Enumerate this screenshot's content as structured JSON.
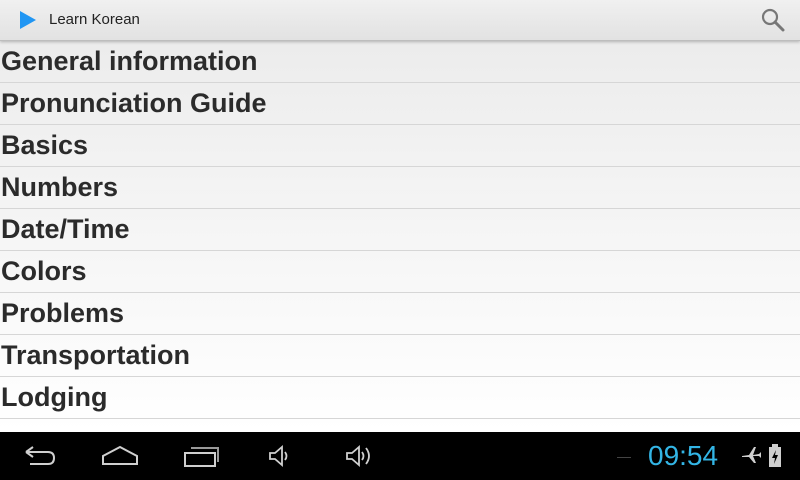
{
  "action_bar": {
    "app_icon": "play-triangle-icon",
    "title": "Learn Korean",
    "search_icon": "search-icon"
  },
  "list": {
    "items": [
      "General information",
      "Pronunciation Guide",
      "Basics",
      "Numbers",
      "Date/Time",
      "Colors",
      "Problems",
      "Transportation",
      "Lodging"
    ]
  },
  "nav_bar": {
    "buttons": [
      "back-icon",
      "home-icon",
      "recent-apps-icon",
      "volume-down-icon",
      "volume-up-icon"
    ],
    "clock": "09:54",
    "status_icons": [
      "airplane-mode-icon",
      "battery-charging-icon"
    ]
  },
  "colors": {
    "accent": "#2196f3",
    "clock": "#33b5e5"
  }
}
